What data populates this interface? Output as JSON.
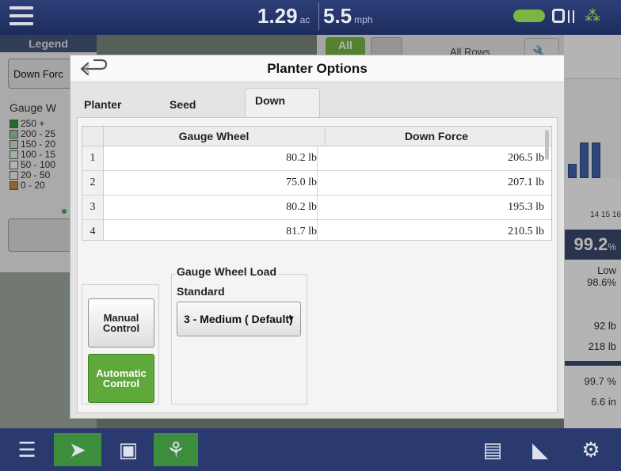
{
  "topbar": {
    "area_value": "1.29",
    "area_unit": "ac",
    "speed_value": "5.5",
    "speed_unit": "mph"
  },
  "legend": {
    "tab_label": "Legend",
    "mode_button": "Down Forc",
    "title": "Gauge W",
    "ranges": [
      {
        "label": "250 +",
        "color": "#2e8b2e"
      },
      {
        "label": "200 - 25",
        "color": "#8fd18f"
      },
      {
        "label": "150 - 20",
        "color": "#c9ecc9"
      },
      {
        "label": "100 - 15",
        "color": "#e8f5e8"
      },
      {
        "label": "50 - 100",
        "color": "#ffffff"
      },
      {
        "label": "20 - 50",
        "color": "#f4f4f4"
      },
      {
        "label": "0 - 20",
        "color": "#c8862b"
      }
    ]
  },
  "behind": {
    "all_label": "All",
    "rows_label": "All Rows"
  },
  "right_panel": {
    "ticks": "14  15  16",
    "big_value": "99.2",
    "big_unit": "%",
    "low_label": "Low",
    "low_value": "98.6%",
    "values": [
      "92 lb",
      "218 lb",
      "99.7 %",
      "6.6 in"
    ]
  },
  "dialog": {
    "title": "Planter Options",
    "tabs": [
      "Planter Drives",
      "Seed Monitor",
      "Down"
    ],
    "active_tab": "Down",
    "table": {
      "columns": [
        "Gauge Wheel",
        "Down Force"
      ],
      "rows": [
        {
          "row": "1",
          "gauge": "80.2 lb",
          "down": "206.5 lb"
        },
        {
          "row": "2",
          "gauge": "75.0 lb",
          "down": "207.1 lb"
        },
        {
          "row": "3",
          "gauge": "80.2 lb",
          "down": "195.3 lb"
        },
        {
          "row": "4",
          "gauge": "81.7 lb",
          "down": "210.5 lb"
        }
      ]
    },
    "manual_control": "Manual Control",
    "automatic_control": "Automatic Control",
    "gauge_wheel_load": {
      "title": "Gauge Wheel Load",
      "subtitle": "Standard",
      "selected": "3 - Medium ( Default)"
    }
  },
  "colors": {
    "accent_green": "#5ea93a",
    "nav_blue": "#2a3a6e"
  }
}
